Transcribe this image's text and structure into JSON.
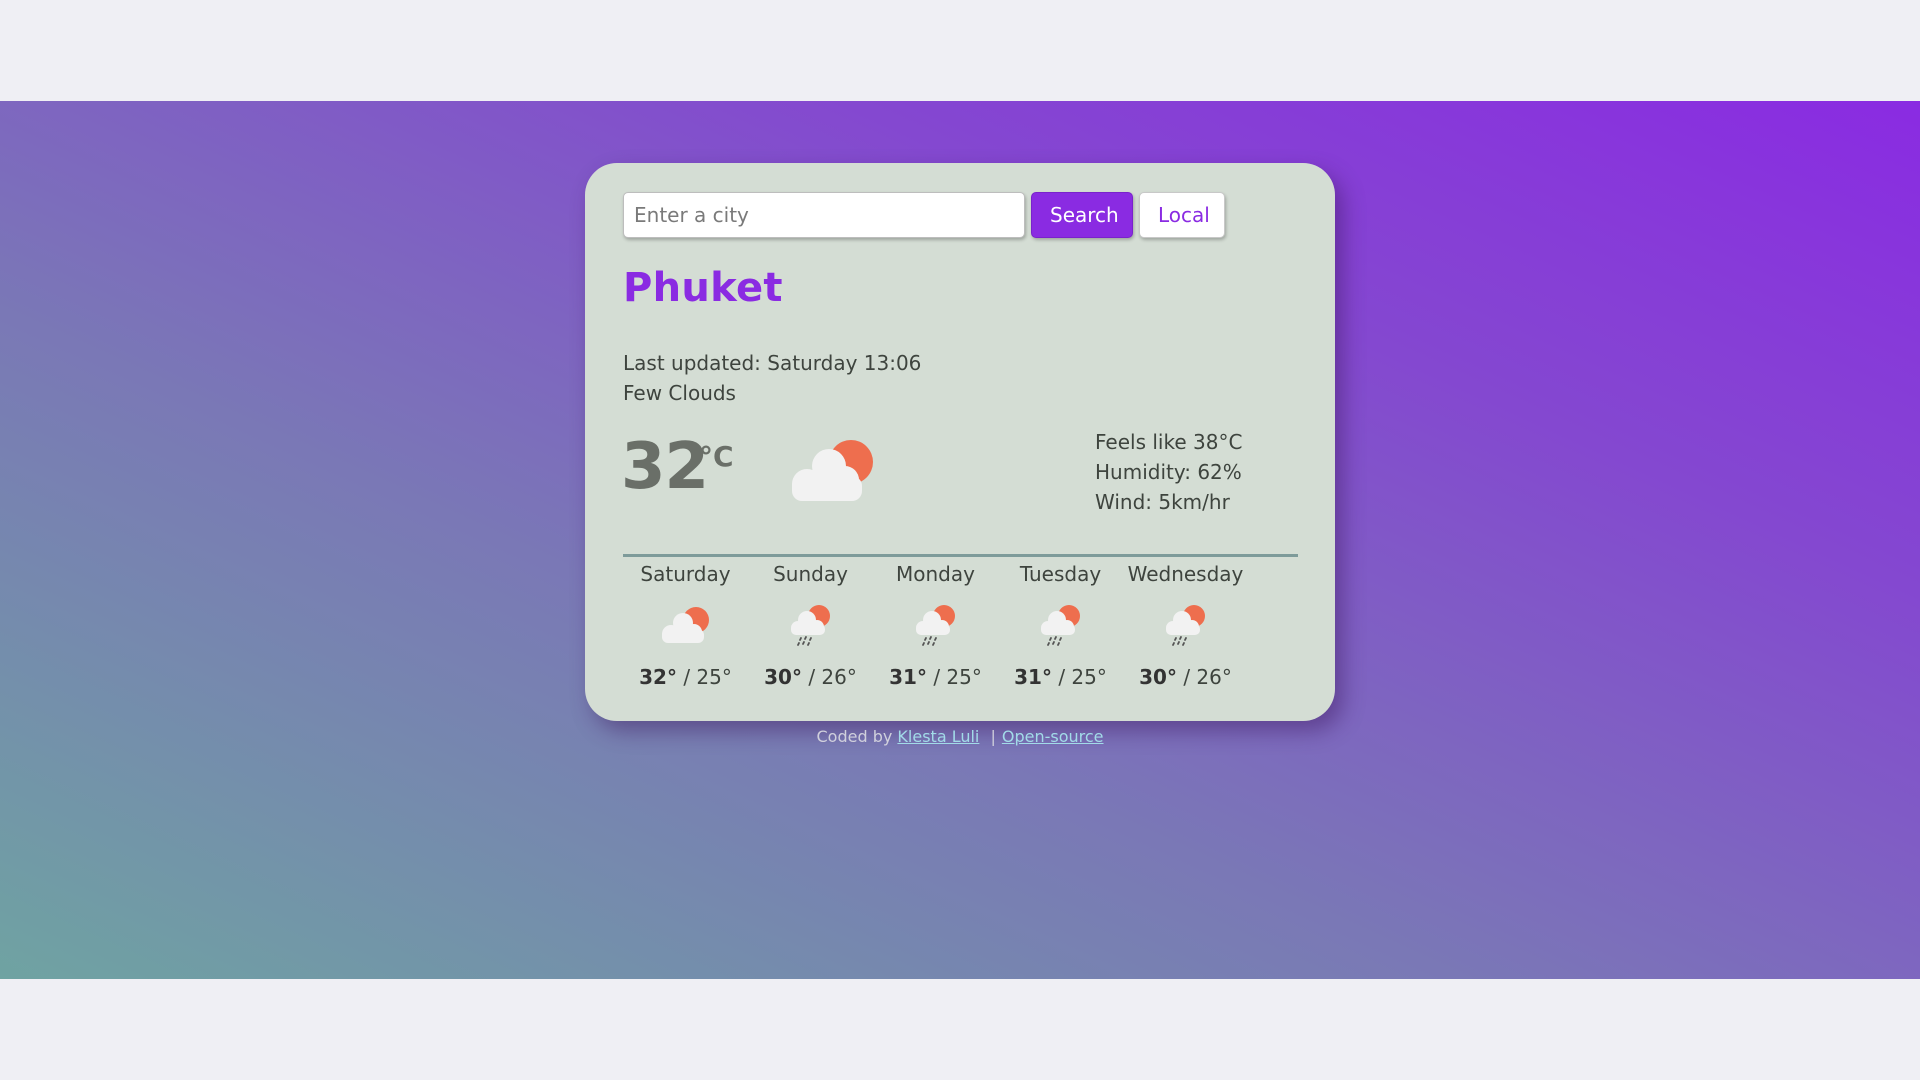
{
  "search": {
    "placeholder": "Enter a city",
    "value": "",
    "search_label": "Search",
    "local_label": "Local"
  },
  "current": {
    "city": "Phuket",
    "last_updated": "Last updated: Saturday 13:06",
    "description": "Few Clouds",
    "temperature": "32",
    "unit": "°C",
    "icon": "few-clouds-icon",
    "feels_like": "Feels like 38°C",
    "humidity": "Humidity: 62%",
    "wind": "Wind: 5km/hr"
  },
  "forecast": [
    {
      "day": "Saturday",
      "icon": "few-clouds-icon",
      "high": "32°",
      "low": "25°"
    },
    {
      "day": "Sunday",
      "icon": "rain-icon",
      "high": "30°",
      "low": "26°"
    },
    {
      "day": "Monday",
      "icon": "rain-icon",
      "high": "31°",
      "low": "25°"
    },
    {
      "day": "Tuesday",
      "icon": "rain-icon",
      "high": "31°",
      "low": "25°"
    },
    {
      "day": "Wednesday",
      "icon": "rain-icon",
      "high": "30°",
      "low": "26°"
    }
  ],
  "footer": {
    "prefix": "Coded by",
    "author_link": "Klesta Luli",
    "separator": "|",
    "source_link": "Open-source"
  },
  "colors": {
    "accent": "#8a2be2",
    "card_background": "#d4ddd4",
    "sun": "#ee6e4e",
    "cloud": "#f2f2f2",
    "gradient_start": "#6fa3a2",
    "gradient_end": "#8a2be2"
  }
}
